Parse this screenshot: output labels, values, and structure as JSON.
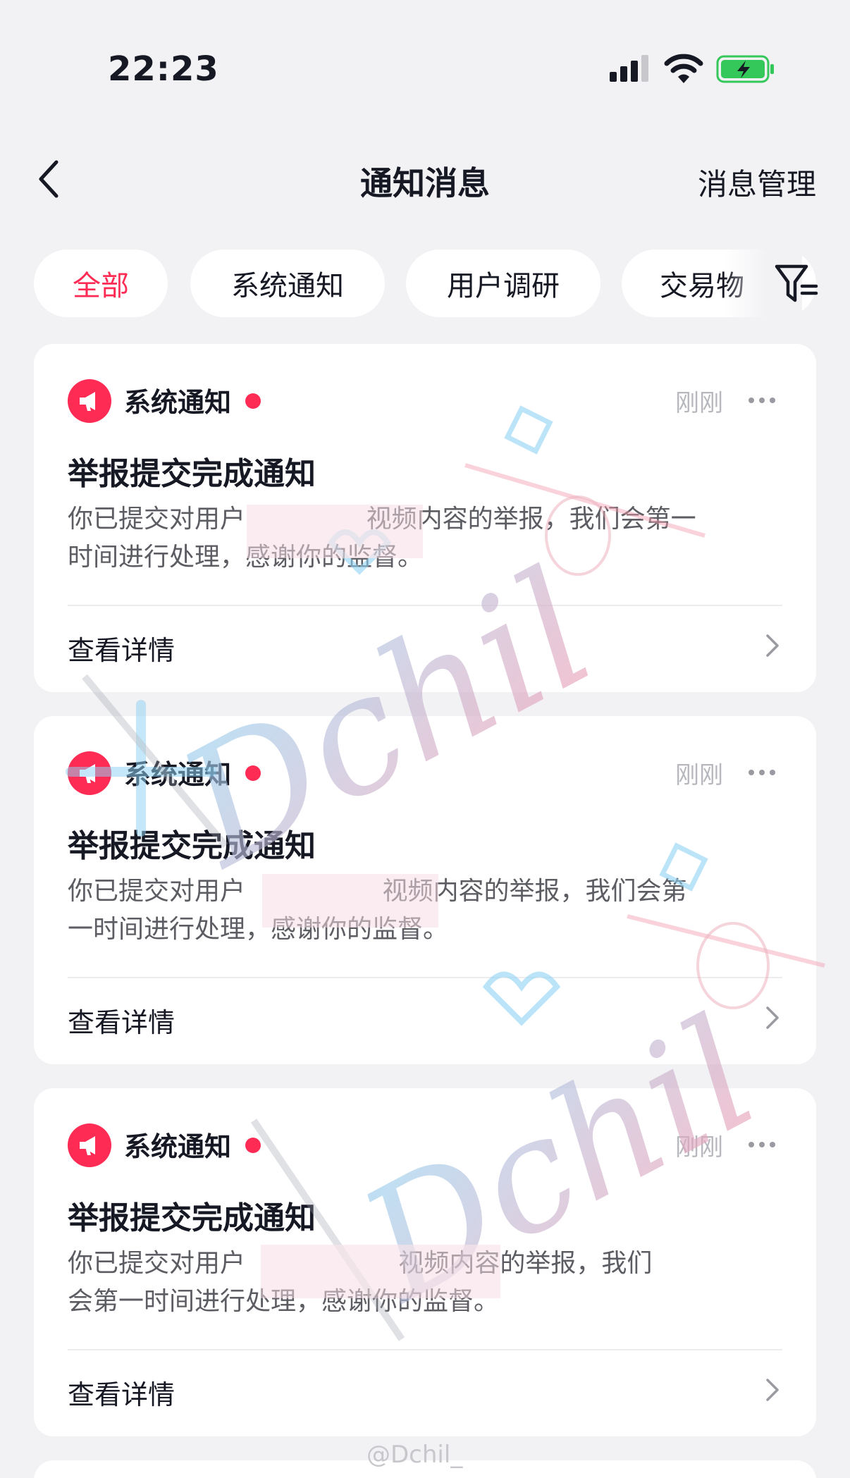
{
  "status_bar": {
    "time": "22:23",
    "signal": "signal-icon",
    "wifi": "wifi-icon",
    "battery": "battery-charging-icon",
    "battery_color": "#34c759"
  },
  "nav": {
    "back": "back-icon",
    "title": "通知消息",
    "manage_label": "消息管理"
  },
  "tabs": [
    {
      "label": "全部",
      "active": true
    },
    {
      "label": "系统通知",
      "active": false
    },
    {
      "label": "用户调研",
      "active": false
    },
    {
      "label": "交易物",
      "active": false
    }
  ],
  "filter": "filter-icon",
  "accent_color": "#fe2c55",
  "cards": [
    {
      "source": "系统通知",
      "time": "刚刚",
      "title": "举报提交完成通知",
      "body_line1": "你已提交对用户               视频内容的举报，我们会第一",
      "body_line2": "时间进行处理，感谢你的监督。",
      "link": "查看详情"
    },
    {
      "source": "系统通知",
      "time": "刚刚",
      "title": "举报提交完成通知",
      "body_line1": "你已提交对用户                 视频内容的举报，我们会第",
      "body_line2": "一时间进行处理，感谢你的监督。",
      "link": "查看详情"
    },
    {
      "source": "系统通知",
      "time": "刚刚",
      "title": "举报提交完成通知",
      "body_line1": "你已提交对用户                   视频内容的举报，我们",
      "body_line2": "会第一时间进行处理，感谢你的监督。",
      "link": "查看详情"
    }
  ],
  "watermark": {
    "text": "Dchil",
    "handle": "@Dchil_"
  }
}
